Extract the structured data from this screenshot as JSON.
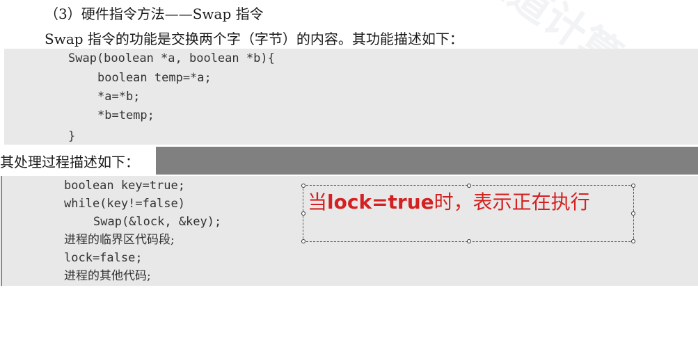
{
  "section": {
    "heading": "（3）硬件指令方法——Swap 指令",
    "intro": "Swap 指令的功能是交换两个字（字节）的内容。其功能描述如下："
  },
  "swap_code": [
    "Swap(boolean *a, boolean *b){",
    "boolean temp=*a;",
    "*a=*b;",
    "*b=temp;",
    "}"
  ],
  "process": {
    "label": "其处理过程描述如下：",
    "code": [
      "boolean key=true;",
      "while(key!=false)",
      "Swap(&lock, &key);",
      "进程的临界区代码段;",
      "lock=false;",
      "进程的其他代码;"
    ]
  },
  "note": {
    "prefix": "当",
    "code": "lock=true",
    "suffix": "时，表示正在执行"
  },
  "watermark": "王道计算机教育"
}
